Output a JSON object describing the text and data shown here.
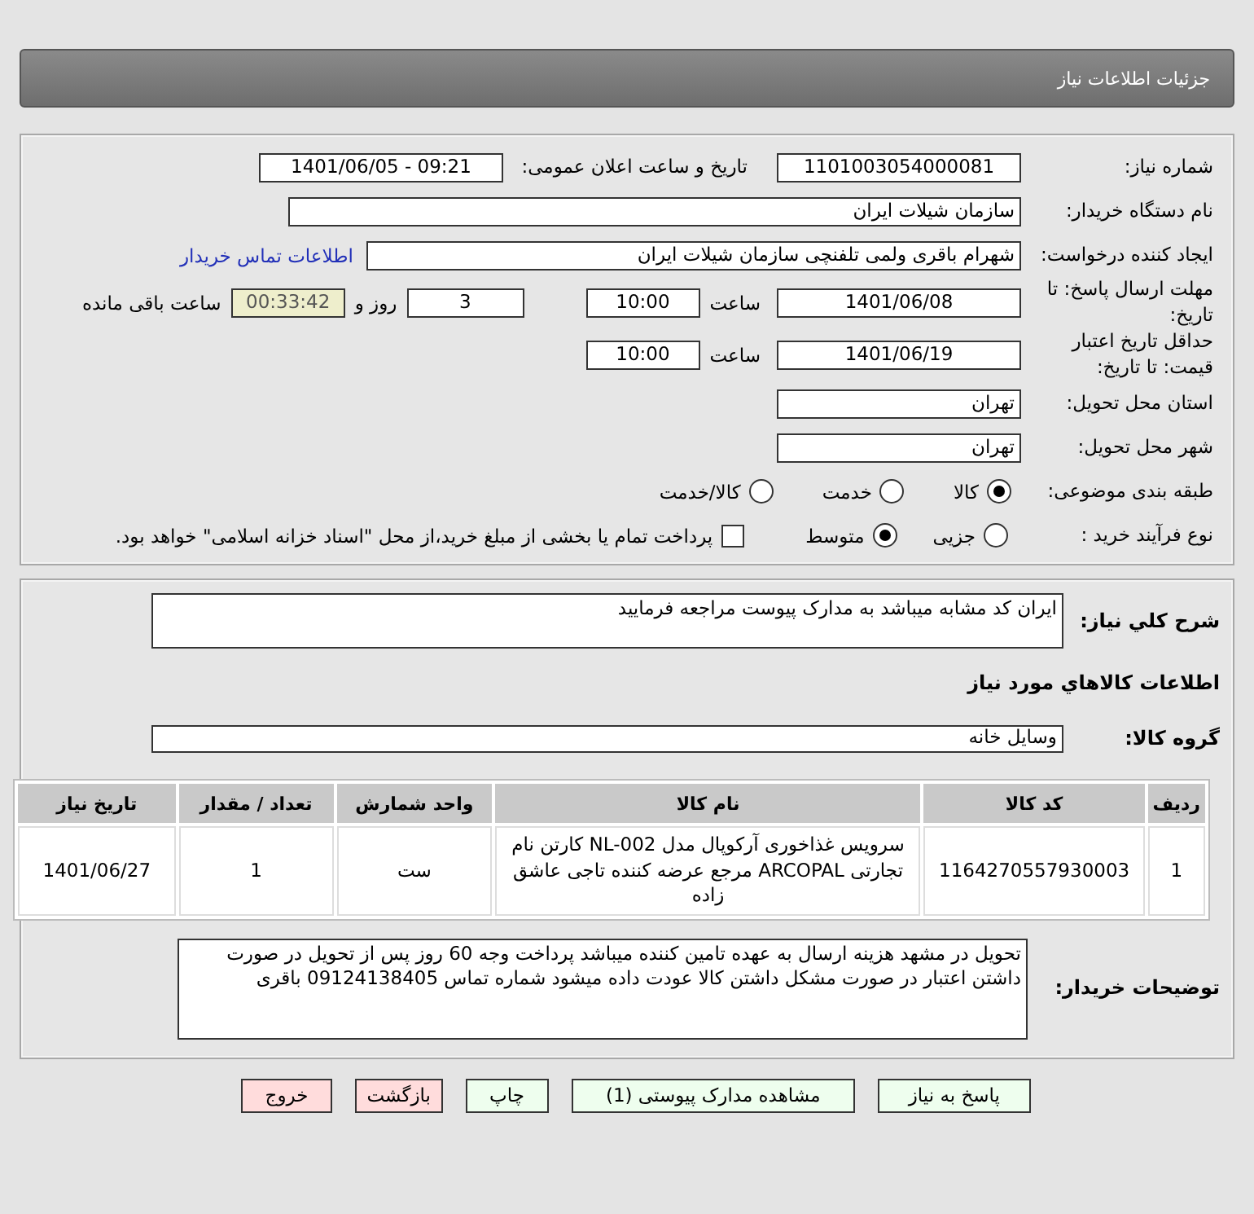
{
  "header": {
    "title": "جزئیات اطلاعات نیاز"
  },
  "need_info": {
    "need_number": {
      "label": "شماره نیاز:",
      "value": "1101003054000081"
    },
    "announce": {
      "label": "تاریخ و ساعت اعلان عمومی:",
      "value": "1401/06/05 - 09:21"
    },
    "buyer": {
      "label": "نام دستگاه خریدار:",
      "value": "سازمان شیلات ایران"
    },
    "requester": {
      "label": "ایجاد کننده درخواست:",
      "value": "شهرام باقری ولمی تلفنچی سازمان شیلات ایران",
      "link": "اطلاعات تماس خریدار"
    },
    "deadline": {
      "label": "مهلت ارسال پاسخ: تا تاریخ:",
      "date": "1401/06/08",
      "time_label": "ساعت",
      "time": "10:00",
      "days": "3",
      "days_label": "روز و",
      "remaining": "00:33:42",
      "remaining_label": "ساعت باقی مانده"
    },
    "validity": {
      "label": "حداقل تاریخ اعتبار قیمت: تا تاریخ:",
      "date": "1401/06/19",
      "time_label": "ساعت",
      "time": "10:00"
    },
    "province": {
      "label": "استان محل تحویل:",
      "value": "تهران"
    },
    "city": {
      "label": "شهر محل تحویل:",
      "value": "تهران"
    },
    "category": {
      "label": "طبقه بندی موضوعی:",
      "options": [
        {
          "label": "کالا",
          "selected": true
        },
        {
          "label": "خدمت",
          "selected": false
        },
        {
          "label": "کالا/خدمت",
          "selected": false
        }
      ]
    },
    "process": {
      "label": "نوع فرآیند خرید :",
      "options": [
        {
          "label": "جزیی",
          "selected": false
        },
        {
          "label": "متوسط",
          "selected": true
        }
      ],
      "payment": {
        "label": "پرداخت تمام یا بخشی از مبلغ خرید،از محل \"اسناد خزانه اسلامی\" خواهد بود.",
        "checked": false
      }
    }
  },
  "goods": {
    "description": {
      "label": "شرح کلي نياز:",
      "value": "ایران کد مشابه میباشد به مدارک پیوست مراجعه فرمایید"
    },
    "section_title": "اطلاعات کالاهاي مورد نياز",
    "group": {
      "label": "گروه کالا:",
      "value": "وسایل خانه"
    },
    "table": {
      "columns": [
        "ردیف",
        "کد کالا",
        "نام کالا",
        "واحد شمارش",
        "تعداد / مقدار",
        "تاریخ نیاز"
      ],
      "rows": [
        [
          "1",
          "1164270557930003",
          "سرویس غذاخوری آرکوپال مدل NL-002 کارتن نام تجارتی ARCOPAL مرجع عرضه کننده تاجی عاشق زاده",
          "ست",
          "1",
          "1401/06/27"
        ]
      ]
    },
    "notes": {
      "label": "توضیحات خریدار:",
      "value": "تحویل در مشهد هزینه ارسال به عهده تامین کننده میباشد پرداخت وجه 60 روز پس از تحویل در صورت داشتن اعتبار در صورت مشکل داشتن کالا عودت داده میشود شماره تماس 09124138405 باقری"
    }
  },
  "buttons": [
    {
      "label": "پاسخ به نیاز",
      "kind": "primary"
    },
    {
      "label": "مشاهده مدارک پیوستی (1)",
      "kind": "primary"
    },
    {
      "label": "چاپ",
      "kind": "primary"
    },
    {
      "label": "بازگشت",
      "kind": "danger"
    },
    {
      "label": "خروج",
      "kind": "danger"
    }
  ]
}
